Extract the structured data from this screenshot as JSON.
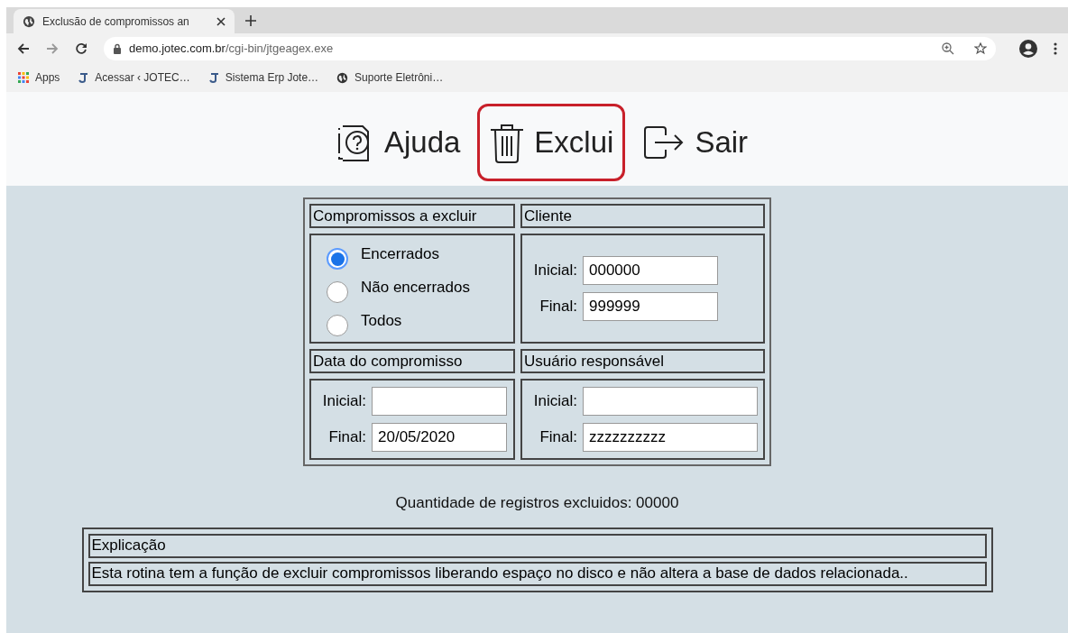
{
  "browser": {
    "tab_title": "Exclusão de compromissos an",
    "url_host": "demo.jotec.com.br",
    "url_path": "/cgi-bin/jtgeagex.exe",
    "bookmarks": [
      {
        "kind": "apps",
        "label": "Apps"
      },
      {
        "kind": "jotec",
        "label": "Acessar ‹ JOTEC…"
      },
      {
        "kind": "jotec",
        "label": "Sistema Erp Jote…"
      },
      {
        "kind": "globe",
        "label": "Suporte Eletrôni…"
      }
    ]
  },
  "toolbar": [
    {
      "kind": "help",
      "label": "Ajuda",
      "selected": false
    },
    {
      "kind": "trash",
      "label": "Exclui",
      "selected": true
    },
    {
      "kind": "exit",
      "label": "Sair",
      "selected": false
    }
  ],
  "compromissos": {
    "title": "Compromissos a excluir",
    "options": [
      {
        "label": "Encerrados",
        "selected": true
      },
      {
        "label": "Não encerrados",
        "selected": false
      },
      {
        "label": "Todos",
        "selected": false
      }
    ]
  },
  "cliente": {
    "title": "Cliente",
    "fields": [
      {
        "label": "Inicial:",
        "value": "000000"
      },
      {
        "label": "Final:",
        "value": "999999"
      }
    ]
  },
  "data": {
    "title": "Data do compromisso",
    "fields": [
      {
        "label": "Inicial:"
      },
      {
        "label": "Final:",
        "value": "20/05/2020"
      }
    ]
  },
  "usuario": {
    "title": "Usuário responsável",
    "fields": [
      {
        "label": "Inicial:"
      },
      {
        "label": "Final:",
        "value": "zzzzzzzzzz"
      }
    ]
  },
  "quantidade": "Quantidade de registros excluidos: 00000",
  "explicacao": {
    "title": "Explicação",
    "text": "Esta rotina tem a função de excluir compromissos liberando espaço no disco e não altera a base de dados relacionada.."
  }
}
